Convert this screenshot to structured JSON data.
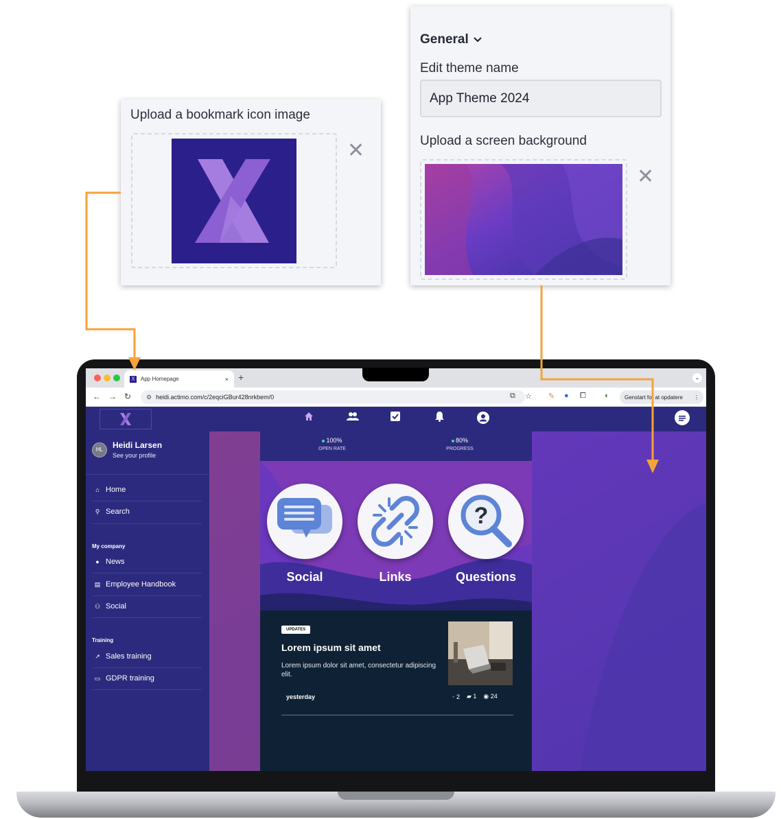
{
  "bookmark_panel": {
    "title": "Upload a bookmark icon image"
  },
  "general_panel": {
    "section_label": "General",
    "theme_name_label": "Edit theme name",
    "theme_name_value": "App Theme 2024",
    "background_label": "Upload a screen background"
  },
  "accent_colors": {
    "arrow": "#f5a33a",
    "brand": "#2c2a7e",
    "logo_purple": "#a57ce0"
  },
  "browser": {
    "tab_title": "App Homepage",
    "tab_close": "×",
    "new_tab": "+",
    "url": "heidi.actimo.com/c/2eqciGBur428nrkbem/0",
    "update_button": "Genstart for at opdatere"
  },
  "app": {
    "nav_icons": [
      "home-icon",
      "people-icon",
      "checklist-icon",
      "bell-icon",
      "account-icon",
      "chat-icon"
    ],
    "profile": {
      "initials": "HL",
      "name": "Heidi Larsen",
      "link": "See your profile"
    },
    "sidebar": {
      "main_items": [
        {
          "label": "Home",
          "icon": "home-icon"
        },
        {
          "label": "Search",
          "icon": "search-icon"
        }
      ],
      "sections": [
        {
          "title": "My company",
          "items": [
            {
              "label": "News",
              "icon": "info-icon"
            },
            {
              "label": "Employee Handbook",
              "icon": "book-icon"
            },
            {
              "label": "Social",
              "icon": "people-icon"
            }
          ]
        },
        {
          "title": "Training",
          "items": [
            {
              "label": "Sales training",
              "icon": "external-icon"
            },
            {
              "label": "GDPR training",
              "icon": "laptop-icon"
            }
          ]
        }
      ]
    },
    "stats": [
      {
        "value": "100%",
        "label": "OPEN RATE"
      },
      {
        "value": "80%",
        "label": "PROGRESS"
      }
    ],
    "tiles": [
      {
        "label": "Social",
        "icon": "chat-bubbles-icon"
      },
      {
        "label": "Links",
        "icon": "broken-link-icon"
      },
      {
        "label": "Questions",
        "icon": "question-magnifier-icon"
      }
    ],
    "card": {
      "badge": "UPDATES",
      "title": "Lorem ipsum sit amet",
      "text": "Lorem ipsum dolor sit amet, consectetur adipiscing elit.",
      "date": "yesterday",
      "reactions": "2",
      "comments": "1",
      "views": "24"
    }
  }
}
